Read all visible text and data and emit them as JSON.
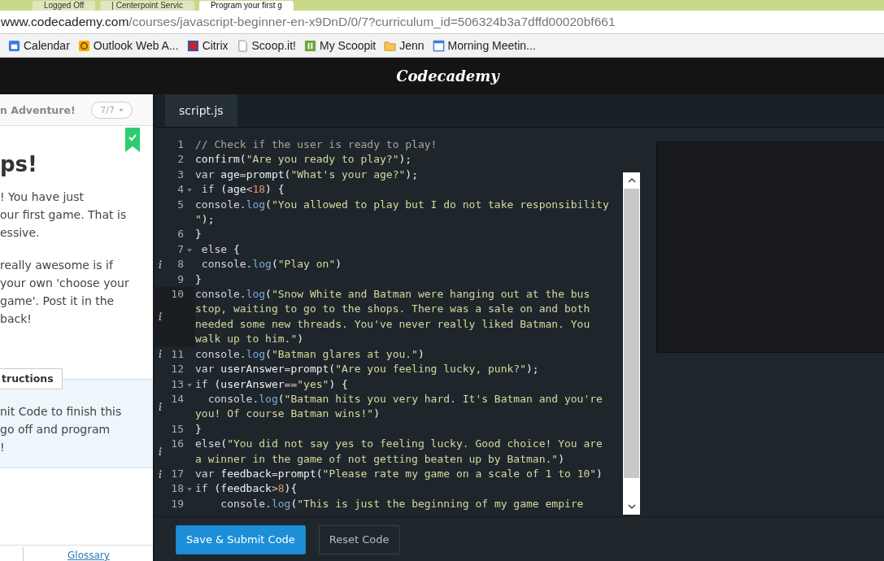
{
  "browser": {
    "tabs": [
      {
        "title": "Logged Off",
        "selected": false
      },
      {
        "title": "| Centerpoint Servic",
        "selected": false
      },
      {
        "title": "Program your first g",
        "selected": true
      }
    ],
    "url": {
      "host": "www.codecademy.com",
      "path": "/courses/javascript-beginner-en-x9DnD/0/7?curriculum_id=506324b3a7dffd00020bf661"
    },
    "bookmarks": [
      {
        "label": "Calendar",
        "kind": "calendar"
      },
      {
        "label": "Outlook Web A...",
        "kind": "outlook"
      },
      {
        "label": "Citrix",
        "kind": "citrix"
      },
      {
        "label": "Scoop.it!",
        "kind": "page"
      },
      {
        "label": "My Scoopit",
        "kind": "scoopit"
      },
      {
        "label": "Jenn",
        "kind": "folder"
      },
      {
        "label": "Morning Meetin...",
        "kind": "window"
      }
    ]
  },
  "app": {
    "logo": "Codecademy"
  },
  "lesson": {
    "course": "n Adventure!",
    "progress": "7/7",
    "completed": true,
    "title": "ps!",
    "paragraphs": [
      [
        "! You have just",
        "our first game. That is",
        "essive."
      ],
      [
        "really awesome is if",
        "your own 'choose your",
        "game'. Post it in the",
        "back!"
      ]
    ],
    "instructions_tab": "tructions",
    "instructions": [
      "nit Code to finish this",
      "go off and program",
      "!"
    ],
    "glossary": "Glossary"
  },
  "editor": {
    "file_tab": "script.js",
    "lines": [
      {
        "number": "1",
        "fold": false,
        "info": false,
        "active": false,
        "segments": [
          {
            "kind": "comment",
            "text": "// Check if the user is ready to play!"
          }
        ]
      },
      {
        "number": "2",
        "fold": false,
        "info": false,
        "active": false,
        "segments": [
          {
            "kind": "plain",
            "text": "confirm("
          },
          {
            "kind": "string",
            "text": "\"Are you ready to play?\""
          },
          {
            "kind": "plain",
            "text": ");"
          }
        ]
      },
      {
        "number": "3",
        "fold": false,
        "info": false,
        "active": false,
        "segments": [
          {
            "kind": "keyword",
            "text": "var"
          },
          {
            "kind": "plain",
            "text": " age"
          },
          {
            "kind": "operator",
            "text": "="
          },
          {
            "kind": "plain",
            "text": "prompt("
          },
          {
            "kind": "string",
            "text": "\"What's your age?\""
          },
          {
            "kind": "plain",
            "text": ");"
          }
        ]
      },
      {
        "number": "4",
        "fold": true,
        "info": false,
        "active": false,
        "segments": [
          {
            "kind": "keyword",
            "text": " if"
          },
          {
            "kind": "plain",
            "text": " (age"
          },
          {
            "kind": "operator",
            "text": "<"
          },
          {
            "kind": "number",
            "text": "18"
          },
          {
            "kind": "plain",
            "text": ") {"
          }
        ]
      },
      {
        "number": "5",
        "fold": false,
        "info": false,
        "active": false,
        "segments": [
          {
            "kind": "keyword",
            "text": "console."
          },
          {
            "kind": "method",
            "text": "log"
          },
          {
            "kind": "plain",
            "text": "("
          },
          {
            "kind": "string",
            "text": "\"You allowed to play but I do not take responsibility"
          },
          {
            "kind": "string",
            "text": "\""
          },
          {
            "kind": "plain",
            "text": ");"
          }
        ]
      },
      {
        "number": "6",
        "fold": false,
        "info": false,
        "active": false,
        "segments": [
          {
            "kind": "plain",
            "text": "}"
          }
        ]
      },
      {
        "number": "7",
        "fold": true,
        "info": false,
        "active": false,
        "segments": [
          {
            "kind": "keyword",
            "text": " else"
          },
          {
            "kind": "plain",
            "text": " {"
          }
        ]
      },
      {
        "number": "8",
        "fold": false,
        "info": true,
        "active": false,
        "segments": [
          {
            "kind": "keyword",
            "text": " console."
          },
          {
            "kind": "method",
            "text": "log"
          },
          {
            "kind": "plain",
            "text": "("
          },
          {
            "kind": "string",
            "text": "\"Play on\""
          },
          {
            "kind": "plain",
            "text": ")"
          }
        ]
      },
      {
        "number": "9",
        "fold": false,
        "info": false,
        "active": false,
        "segments": [
          {
            "kind": "plain",
            "text": "}"
          }
        ]
      },
      {
        "number": "10",
        "fold": false,
        "info": true,
        "active": true,
        "segments": [
          {
            "kind": "keyword",
            "text": "console."
          },
          {
            "kind": "method",
            "text": "log"
          },
          {
            "kind": "plain",
            "text": "("
          },
          {
            "kind": "string",
            "text": "\"Snow White and Batman were hanging out at the bus stop, waiting to go to the shops. There was a sale on and both needed some new threads. You've never really liked Batman. You walk up to him.\""
          },
          {
            "kind": "plain",
            "text": ")"
          }
        ]
      },
      {
        "number": "11",
        "fold": false,
        "info": true,
        "active": false,
        "segments": [
          {
            "kind": "keyword",
            "text": "console."
          },
          {
            "kind": "method",
            "text": "log"
          },
          {
            "kind": "plain",
            "text": "("
          },
          {
            "kind": "string",
            "text": "\"Batman glares at you.\""
          },
          {
            "kind": "plain",
            "text": ")"
          }
        ]
      },
      {
        "number": "12",
        "fold": false,
        "info": false,
        "active": false,
        "segments": [
          {
            "kind": "keyword",
            "text": "var"
          },
          {
            "kind": "plain",
            "text": " userAnswer"
          },
          {
            "kind": "operator",
            "text": "="
          },
          {
            "kind": "plain",
            "text": "prompt("
          },
          {
            "kind": "string",
            "text": "\"Are you feeling lucky, punk?\""
          },
          {
            "kind": "plain",
            "text": ");"
          }
        ]
      },
      {
        "number": "13",
        "fold": true,
        "info": false,
        "active": false,
        "segments": [
          {
            "kind": "keyword",
            "text": "if"
          },
          {
            "kind": "plain",
            "text": " (userAnswer"
          },
          {
            "kind": "operator",
            "text": "=="
          },
          {
            "kind": "string",
            "text": "\"yes\""
          },
          {
            "kind": "plain",
            "text": ") {"
          }
        ]
      },
      {
        "number": "14",
        "fold": false,
        "info": true,
        "active": false,
        "segments": [
          {
            "kind": "keyword",
            "text": "  console."
          },
          {
            "kind": "method",
            "text": "log"
          },
          {
            "kind": "plain",
            "text": "("
          },
          {
            "kind": "string",
            "text": "\"Batman hits you very hard. It's Batman and you're you! Of course Batman wins!\""
          },
          {
            "kind": "plain",
            "text": ")"
          }
        ]
      },
      {
        "number": "15",
        "fold": false,
        "info": false,
        "active": false,
        "segments": [
          {
            "kind": "plain",
            "text": "}"
          }
        ]
      },
      {
        "number": "16",
        "fold": false,
        "info": true,
        "active": false,
        "segments": [
          {
            "kind": "keyword",
            "text": "else"
          },
          {
            "kind": "plain",
            "text": "("
          },
          {
            "kind": "string",
            "text": "\"You did not say yes to feeling lucky. Good choice! You are a winner in the game of not getting beaten up by Batman.\""
          },
          {
            "kind": "plain",
            "text": ")"
          }
        ]
      },
      {
        "number": "17",
        "fold": false,
        "info": true,
        "active": false,
        "segments": [
          {
            "kind": "keyword",
            "text": "var"
          },
          {
            "kind": "plain",
            "text": " feedback"
          },
          {
            "kind": "operator",
            "text": "="
          },
          {
            "kind": "plain",
            "text": "prompt("
          },
          {
            "kind": "string",
            "text": "\"Please rate my game on a scale of 1 to 10\""
          },
          {
            "kind": "plain",
            "text": ")"
          }
        ]
      },
      {
        "number": "18",
        "fold": true,
        "info": false,
        "active": false,
        "segments": [
          {
            "kind": "keyword",
            "text": "if"
          },
          {
            "kind": "plain",
            "text": " (feedback"
          },
          {
            "kind": "operator",
            "text": ">"
          },
          {
            "kind": "number",
            "text": "8"
          },
          {
            "kind": "plain",
            "text": "){"
          }
        ]
      },
      {
        "number": "19",
        "fold": false,
        "info": false,
        "active": false,
        "segments": [
          {
            "kind": "keyword",
            "text": "    console."
          },
          {
            "kind": "method",
            "text": "log"
          },
          {
            "kind": "plain",
            "text": "("
          },
          {
            "kind": "string",
            "text": "\"This is just the beginning of my game empire"
          }
        ]
      }
    ]
  },
  "buttons": [
    {
      "label": "Save & Submit Code",
      "kind": "primary"
    },
    {
      "label": "Reset Code",
      "kind": "secondary"
    }
  ]
}
